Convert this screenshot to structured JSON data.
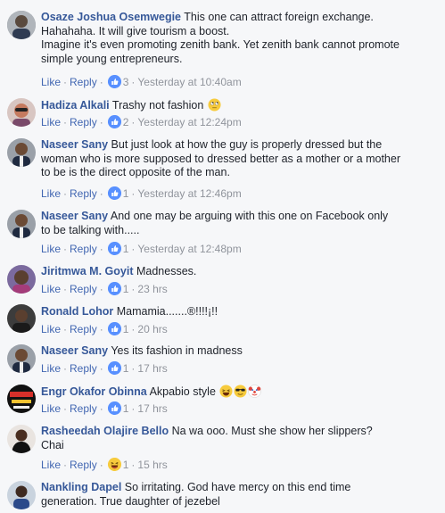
{
  "comments": [
    {
      "author": "Osaze Joshua Osemwegie",
      "lines": [
        "This one can attract foreign exchange.",
        "Hahahaha. It will give tourism a boost.",
        "Imagine it's even promoting zenith bank. Yet zenith bank cannot promote",
        "simple young entrepreneurs."
      ],
      "like": "Like",
      "reply": "Reply",
      "reaction": "like",
      "count": "3",
      "time": "Yesterday at 10:40am"
    },
    {
      "author": "Hadiza Alkali",
      "lines": [
        "Trashy not fashion"
      ],
      "emoji": [
        "rolling-eyes-emoji"
      ],
      "like": "Like",
      "reply": "Reply",
      "reaction": "like",
      "count": "2",
      "time": "Yesterday at 12:24pm"
    },
    {
      "author": "Naseer Sany",
      "lines": [
        "But just look at how the guy is properly dressed but the",
        "woman who is more supposed to dressed better as a mother or a mother",
        "to be is the direct opposite of the man."
      ],
      "like": "Like",
      "reply": "Reply",
      "reaction": "like",
      "count": "1",
      "time": "Yesterday at 12:46pm"
    },
    {
      "author": "Naseer Sany",
      "lines": [
        "And one may be arguing with this one on Facebook only",
        "to be talking with....."
      ],
      "like": "Like",
      "reply": "Reply",
      "reaction": "like",
      "count": "1",
      "time": "Yesterday at 12:48pm"
    },
    {
      "author": "Jiritmwa M. Goyit",
      "lines": [
        "Madnesses."
      ],
      "like": "Like",
      "reply": "Reply",
      "reaction": "like",
      "count": "1",
      "time": "23 hrs"
    },
    {
      "author": "Ronald Lohor",
      "lines": [
        "Mamamia.......®!!!!¡!!"
      ],
      "like": "Like",
      "reply": "Reply",
      "reaction": "like",
      "count": "1",
      "time": "20 hrs"
    },
    {
      "author": "Naseer Sany",
      "lines": [
        "Yes its fashion in madness"
      ],
      "like": "Like",
      "reply": "Reply",
      "reaction": "like",
      "count": "1",
      "time": "17 hrs"
    },
    {
      "author": "Engr Okafor Obinna",
      "lines": [
        "Akpabio style"
      ],
      "emoji": [
        "laughing-emoji",
        "sunglasses-emoji",
        "clown-emoji"
      ],
      "like": "Like",
      "reply": "Reply",
      "reaction": "like",
      "count": "1",
      "time": "17 hrs"
    },
    {
      "author": "Rasheedah Olajire Bello",
      "lines": [
        "Na wa ooo. Must she show her slippers?",
        "Chai"
      ],
      "like": "Like",
      "reply": "Reply",
      "reaction": "haha",
      "count": "1",
      "time": "15 hrs"
    },
    {
      "author": "Nankling Dapel",
      "lines": [
        "So irritating. God have mercy on this end time",
        "generation. True daughter of jezebel"
      ]
    }
  ],
  "colors": {
    "background": "#f6f7f9",
    "author": "#365899",
    "link": "#4267b2",
    "meta": "#90949c",
    "like_badge": "#5890ff"
  }
}
